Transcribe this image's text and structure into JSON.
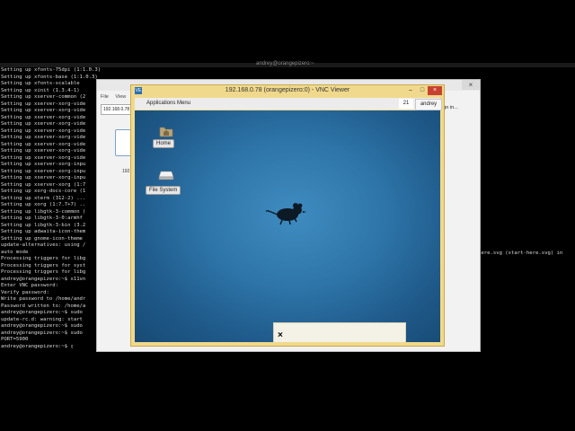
{
  "terminal": {
    "title": "andrey@orangepizero:~",
    "lines": [
      "Setting up xfonts-75dpi (1:1.0.3) ...",
      "Setting up xfonts-base (1:1.0.3) ...",
      "Setting up xfonts-scalable",
      "Setting up xinit (1.3.4-1)",
      "Setting up xserver-common (2",
      "Setting up xserver-xorg-vide",
      "Setting up xserver-xorg-vide",
      "Setting up xserver-xorg-vide",
      "Setting up xserver-xorg-vide",
      "Setting up xserver-xorg-vide",
      "Setting up xserver-xorg-vide",
      "Setting up xserver-xorg-vide",
      "Setting up xserver-xorg-vide",
      "Setting up xserver-xorg-vide",
      "Setting up xserver-xorg-inpu",
      "Setting up xserver-xorg-inpu",
      "Setting up xserver-xorg-inpu",
      "Setting up xserver-xorg (1:7",
      "Setting up xorg-docs-core (1",
      "Setting up xterm (312-2) ...",
      "Setting up xorg (1:7.7+7) ..",
      "Setting up libgtk-3-common (",
      "Setting up libgtk-3-0:armhf",
      "Setting up libgtk-3-bin (3.2",
      "Setting up adwaita-icon-them",
      "Setting up gnome-icon-theme",
      "update-alternatives: using /",
      "auto mode",
      "Processing triggers for libg",
      "Processing triggers for syst",
      "Processing triggers for libg",
      "andrey@orangepizero:~$ x11vn",
      "Enter VNC password:",
      "Verify password:",
      "Write password to /home/andr",
      "Password written to: /home/a",
      "andrey@orangepizero:~$ sudo",
      "update-rc.d: warning: start",
      "andrey@orangepizero:~$ sudo",
      "andrey@orangepizero:~$ sudo",
      "PORT=5900",
      "andrey@orangepizero:~$ ▯"
    ],
    "right_text": "here.svg (start-here.svg) in"
  },
  "outer_window": {
    "menu": [
      "File",
      "View"
    ],
    "host": "192.168.0.78",
    "thumb_label": "192.",
    "sign_in": "ign in..."
  },
  "vnc": {
    "logo": "VE",
    "title": "192.168.0.78 (orangepizero:0) - VNC Viewer",
    "minimize": "–",
    "maximize": "□",
    "close": "×",
    "panel": {
      "apps_menu": "Applications Menu",
      "workspace": "21",
      "user": "andrey"
    },
    "desktop_icons": [
      {
        "label": "Home",
        "icon": "home-folder-icon"
      },
      {
        "label": "File System",
        "icon": "drive-icon"
      }
    ],
    "notification_close": "×"
  }
}
